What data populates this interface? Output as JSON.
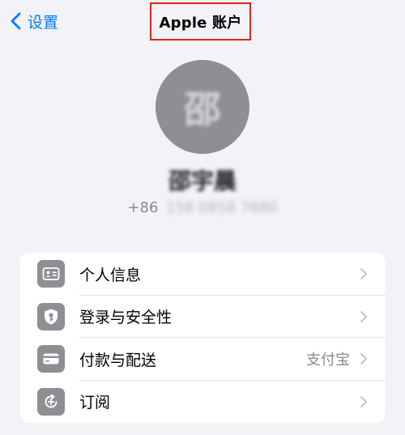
{
  "nav": {
    "back_label": "设置",
    "title": "Apple 账户"
  },
  "profile": {
    "avatar_initial": "邵",
    "name": "邵宇晨",
    "phone_code": "+86",
    "phone_number": "158 0858 7680"
  },
  "menu": {
    "items": [
      {
        "label": "个人信息",
        "value": "",
        "icon": "person-card-icon"
      },
      {
        "label": "登录与安全性",
        "value": "",
        "icon": "key-shield-icon"
      },
      {
        "label": "付款与配送",
        "value": "支付宝",
        "icon": "credit-card-icon"
      },
      {
        "label": "订阅",
        "value": "",
        "icon": "subscription-icon"
      }
    ]
  },
  "colors": {
    "accent": "#007aff",
    "highlight": "#e0241b",
    "background": "#f2f2f7",
    "icon_bg": "#8e8e93"
  }
}
